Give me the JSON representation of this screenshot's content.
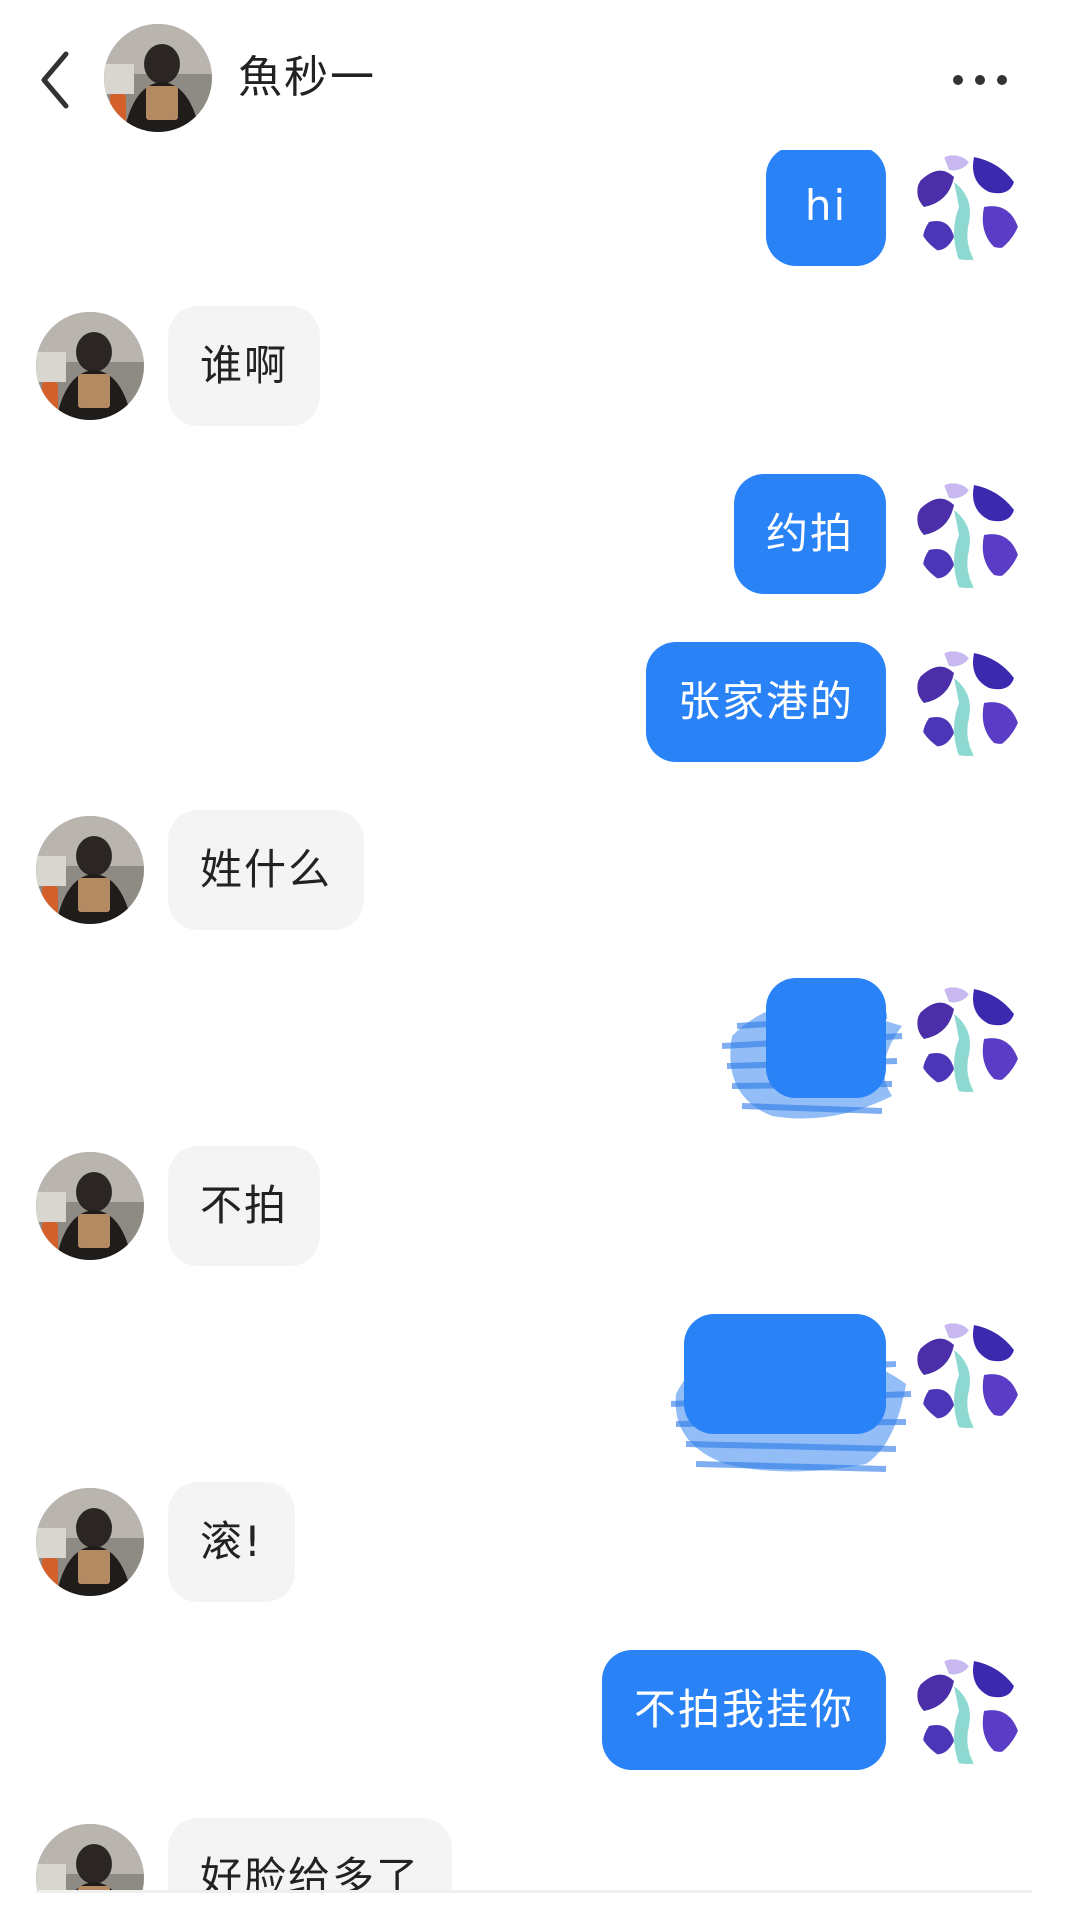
{
  "header": {
    "contact_name": "魚秒一",
    "back_icon": "chevron-left-icon",
    "more_icon": "more-horizontal-icon"
  },
  "colors": {
    "outgoing_bubble": "#2a82f7",
    "incoming_bubble": "#f4f4f4",
    "outgoing_text": "#ffffff",
    "incoming_text": "#222222"
  },
  "messages": [
    {
      "from": "me",
      "text": "hi"
    },
    {
      "from": "them",
      "text": "谁啊"
    },
    {
      "from": "me",
      "text": "约拍"
    },
    {
      "from": "me",
      "text": "张家港的"
    },
    {
      "from": "them",
      "text": "姓什么"
    },
    {
      "from": "me",
      "text": "",
      "redacted": true
    },
    {
      "from": "them",
      "text": "不拍"
    },
    {
      "from": "me",
      "text": "",
      "redacted": true
    },
    {
      "from": "them",
      "text": "滚!"
    },
    {
      "from": "me",
      "text": "不拍我挂你"
    },
    {
      "from": "them",
      "text": "好脸给多了"
    }
  ]
}
